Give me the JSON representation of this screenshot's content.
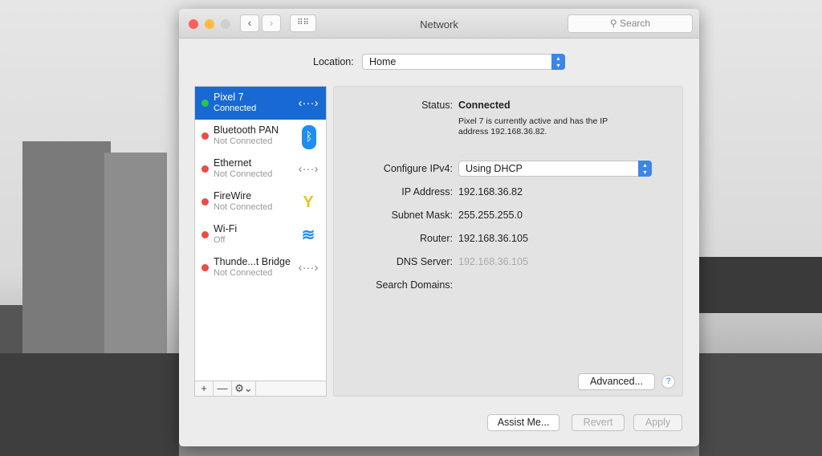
{
  "window": {
    "title": "Network",
    "search_placeholder": "Search"
  },
  "location": {
    "label": "Location:",
    "value": "Home"
  },
  "services": [
    {
      "name": "Pixel 7",
      "status": "Connected",
      "status_color": "#28c840",
      "icon": "ethernet-arrows-icon",
      "glyph": "‹···›"
    },
    {
      "name": "Bluetooth PAN",
      "status": "Not Connected",
      "status_color": "#ee4b43",
      "icon": "bluetooth-icon",
      "glyph": "ᛒ"
    },
    {
      "name": "Ethernet",
      "status": "Not Connected",
      "status_color": "#ee4b43",
      "icon": "ethernet-arrows-icon",
      "glyph": "‹···›"
    },
    {
      "name": "FireWire",
      "status": "Not Connected",
      "status_color": "#ee4b43",
      "icon": "firewire-icon",
      "glyph": "Y"
    },
    {
      "name": "Wi-Fi",
      "status": "Off",
      "status_color": "#ee4b43",
      "icon": "wifi-icon",
      "glyph": "≋"
    },
    {
      "name": "Thunde...t Bridge",
      "status": "Not Connected",
      "status_color": "#ee4b43",
      "icon": "ethernet-arrows-icon",
      "glyph": "‹···›"
    }
  ],
  "list_toolbar": {
    "add": "+",
    "remove": "—",
    "gear": "⚙⌄"
  },
  "detail": {
    "status_label": "Status:",
    "status_value": "Connected",
    "status_desc": "Pixel 7 is currently active and has the IP address 192.168.36.82.",
    "ipv4_label": "Configure IPv4:",
    "ipv4_value": "Using DHCP",
    "ip_label": "IP Address:",
    "ip_value": "192.168.36.82",
    "mask_label": "Subnet Mask:",
    "mask_value": "255.255.255.0",
    "router_label": "Router:",
    "router_value": "192.168.36.105",
    "dns_label": "DNS Server:",
    "dns_value": "192.168.36.105",
    "domains_label": "Search Domains:",
    "advanced": "Advanced...",
    "help": "?"
  },
  "footer": {
    "assist": "Assist Me...",
    "revert": "Revert",
    "apply": "Apply"
  }
}
